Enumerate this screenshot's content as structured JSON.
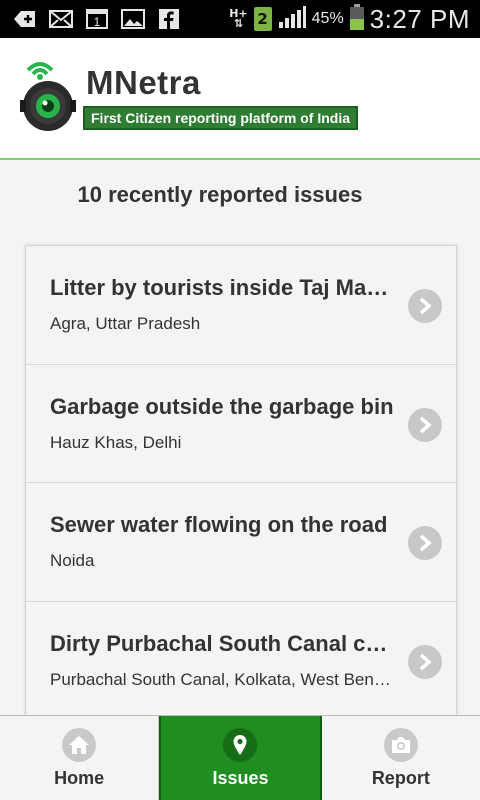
{
  "status_bar": {
    "icons": [
      "add-icon",
      "email-icon",
      "calendar-icon",
      "gallery-icon",
      "facebook-icon"
    ],
    "network": "H+",
    "sim_slot": "2",
    "battery": "45%",
    "time": "3:27 PM"
  },
  "header": {
    "brand": "MNetra",
    "tagline": "First Citizen reporting platform of India"
  },
  "section_title": "10 recently reported issues",
  "issues": [
    {
      "title": "Litter by tourists inside Taj Mahal premises",
      "location": "Agra, Uttar Pradesh"
    },
    {
      "title": "Garbage outside the garbage bin",
      "location": "Hauz Khas, Delhi"
    },
    {
      "title": "Sewer water flowing on the road",
      "location": "Noida"
    },
    {
      "title": "Dirty Purbachal South Canal condition",
      "location": "Purbachal South Canal, Kolkata, West Bengal"
    }
  ],
  "bottom_nav": {
    "tabs": [
      {
        "label": "Home",
        "icon": "home-icon",
        "active": false
      },
      {
        "label": "Issues",
        "icon": "location-pin-icon",
        "active": true
      },
      {
        "label": "Report",
        "icon": "camera-icon",
        "active": false
      }
    ]
  },
  "colors": {
    "accent_green": "#1f8d1f",
    "header_divider": "#7bd36b",
    "tagline_bg": "#2e7d32"
  }
}
